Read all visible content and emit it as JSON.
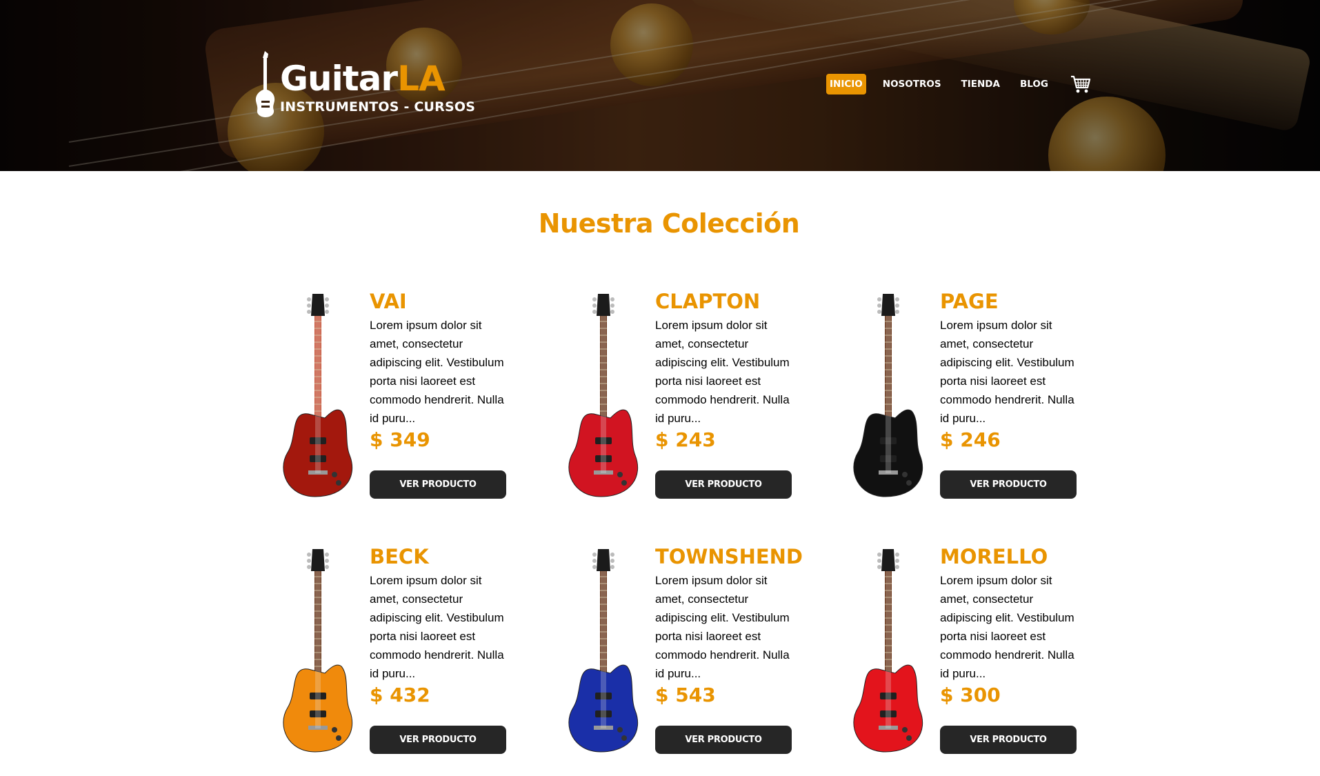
{
  "brand": {
    "name_white": "Guitar",
    "name_orange": "LA",
    "tagline": "INSTRUMENTOS - CURSOS"
  },
  "nav": {
    "items": [
      {
        "label": "INICIO",
        "active": true
      },
      {
        "label": "NOSOTROS",
        "active": false
      },
      {
        "label": "TIENDA",
        "active": false
      },
      {
        "label": "BLOG",
        "active": false
      }
    ],
    "cart_icon": "cart-icon"
  },
  "section_title": "Nuestra Colección",
  "colors": {
    "accent": "#e99401",
    "button": "#262626",
    "text": "#000000"
  },
  "products": [
    {
      "name": "VAI",
      "description": "Lorem ipsum dolor sit amet, consectetur adipiscing elit. Vestibulum porta nisi laoreet est commodo hendrerit. Nulla id puru...",
      "price": "$ 349",
      "button": "VER PRODUCTO",
      "body_color": "#a3180d"
    },
    {
      "name": "CLAPTON",
      "description": "Lorem ipsum dolor sit amet, consectetur adipiscing elit. Vestibulum porta nisi laoreet est commodo hendrerit. Nulla id puru...",
      "price": "$ 243",
      "button": "VER PRODUCTO",
      "body_color": "#d11421"
    },
    {
      "name": "PAGE",
      "description": "Lorem ipsum dolor sit amet, consectetur adipiscing elit. Vestibulum porta nisi laoreet est commodo hendrerit. Nulla id puru...",
      "price": "$ 246",
      "button": "VER PRODUCTO",
      "body_color": "#111111"
    },
    {
      "name": "BECK",
      "description": "Lorem ipsum dolor sit amet, consectetur adipiscing elit. Vestibulum porta nisi laoreet est commodo hendrerit. Nulla id puru...",
      "price": "$ 432",
      "button": "VER PRODUCTO",
      "body_color": "#f08a0c"
    },
    {
      "name": "TOWNSHEND",
      "description": "Lorem ipsum dolor sit amet, consectetur adipiscing elit. Vestibulum porta nisi laoreet est commodo hendrerit. Nulla id puru...",
      "price": "$ 543",
      "button": "VER PRODUCTO",
      "body_color": "#1a2fa8"
    },
    {
      "name": "MORELLO",
      "description": "Lorem ipsum dolor sit amet, consectetur adipiscing elit. Vestibulum porta nisi laoreet est commodo hendrerit. Nulla id puru...",
      "price": "$ 300",
      "button": "VER PRODUCTO",
      "body_color": "#e3141c"
    }
  ]
}
